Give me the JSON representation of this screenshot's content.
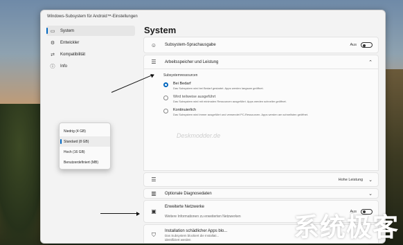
{
  "window": {
    "title": "Windows-Subsystem für Android™-Einstellungen"
  },
  "sidebar": {
    "items": [
      {
        "label": "System",
        "icon": "system-icon",
        "active": true
      },
      {
        "label": "Entwickler",
        "icon": "developer-icon",
        "active": false
      },
      {
        "label": "Kompatibilität",
        "icon": "compatibility-icon",
        "active": false
      },
      {
        "label": "Info",
        "icon": "info-icon",
        "active": false
      }
    ]
  },
  "main": {
    "page_title": "System",
    "subsystem_voice": {
      "title": "Subsystem-Sprachausgabe",
      "toggle_label": "Aus"
    },
    "memory": {
      "title": "Arbeitsspeicher und Leistung",
      "section_label": "Subsystemressourcen",
      "options": [
        {
          "title": "Bei Bedarf",
          "desc": "Das Subsystem wird bei Bedarf gestartet. Apps werden langsam geöffnet.",
          "checked": true
        },
        {
          "title": "Wird teilweise ausgeführt",
          "desc": "Das Subsystem wird mit minimalen Ressourcen ausgeführt. Apps werden schneller geöffnet.",
          "checked": false
        },
        {
          "title": "Kontinuierlich",
          "desc": "Das Subsystem wird immer ausgeführt und verwendet PC-Ressourcen. Apps werden am schnellsten geöffnet.",
          "checked": false
        }
      ],
      "dropdown": [
        "Niedrig (4 GB)",
        "Standard (8 GB)",
        "Hoch (16 GB)",
        "Benutzerdefiniert (MB)"
      ],
      "dropdown_selected": 1
    },
    "performance": {
      "select_value": "Hohe Leistung"
    },
    "diagnostics": {
      "title": "Optionale Diagnosedaten"
    },
    "extended_network": {
      "title": "Erweiterte Netzwerke",
      "desc": "Weitere Informationen zu erweiterten Netzwerken",
      "toggle_label": "Aus"
    },
    "harmful_apps": {
      "title": "Installation schädlicher Apps blo...",
      "desc_line1": "Das Subsystem blockiert die Installati...",
      "desc_line2": "identifiziert werden"
    }
  },
  "watermark": {
    "text": "系统极客",
    "faint": "Deskmodder.de"
  },
  "colors": {
    "accent": "#0067c0"
  }
}
